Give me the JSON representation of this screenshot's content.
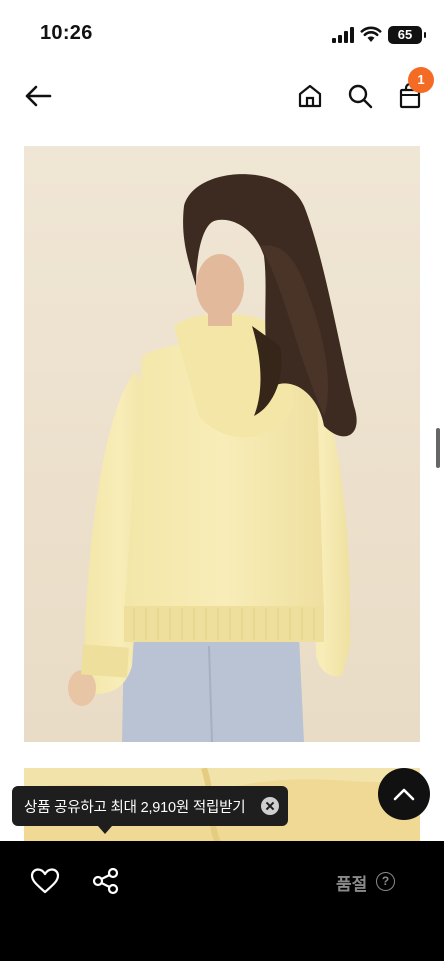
{
  "status_bar": {
    "time": "10:26",
    "battery": "65"
  },
  "nav": {
    "back_icon": "arrow-left-icon",
    "home_icon": "home-icon",
    "search_icon": "search-icon",
    "bag_icon": "shopping-bag-icon",
    "cart_badge": "1",
    "badge_color": "#f46b25"
  },
  "tooltip": {
    "text": "상품 공유하고 최대 2,910원 적립받기",
    "close_icon": "close-circle-icon"
  },
  "scroll_top_icon": "chevron-up-icon",
  "bottom_bar": {
    "like_icon": "heart-icon",
    "share_icon": "share-icon",
    "status_label": "품절",
    "help_label": "?"
  }
}
